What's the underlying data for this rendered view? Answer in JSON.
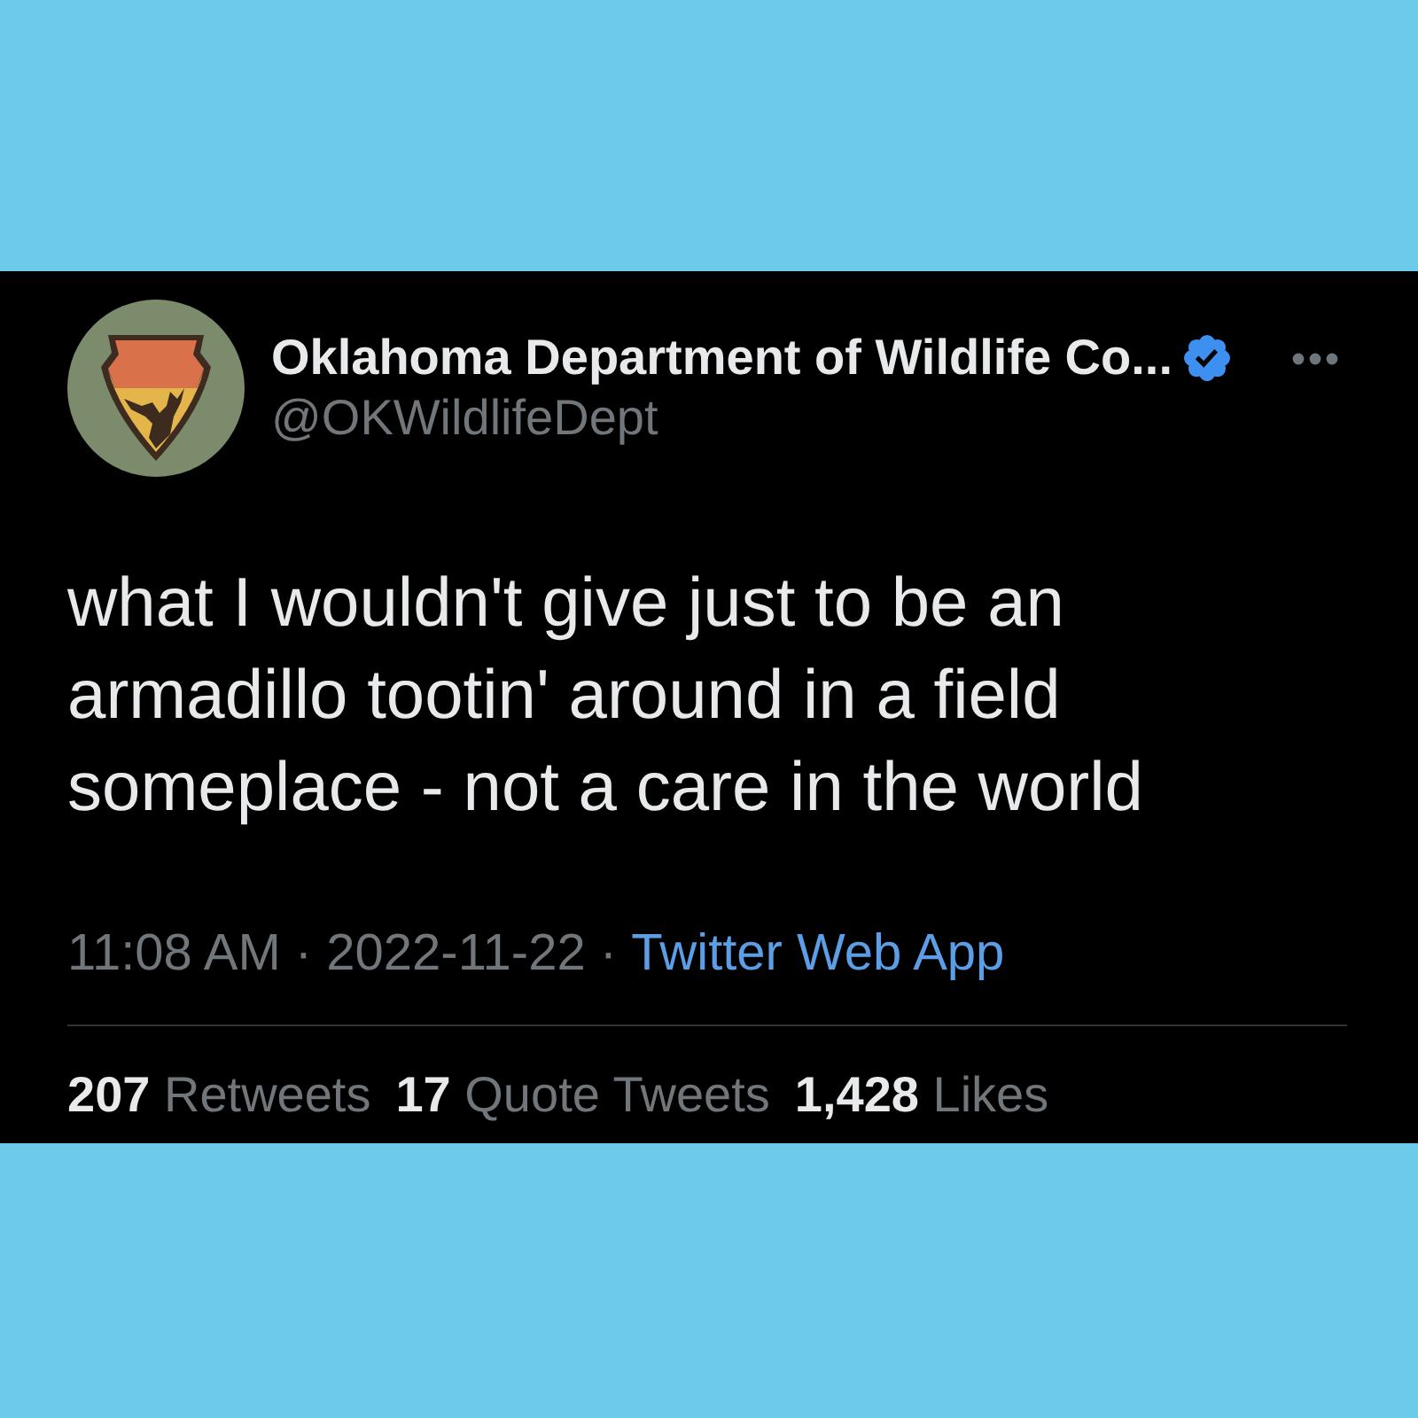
{
  "tweet": {
    "author": {
      "name": "Oklahoma Department of Wildlife Co...",
      "verified": true,
      "handle": "@OKWildlifeDept"
    },
    "text": "what I wouldn't give just to be an armadillo tootin' around in a field someplace - not a care in the world",
    "timestamp": "11:08 AM · 2022-11-22 ·",
    "source": "Twitter Web App",
    "stats": [
      {
        "text": "**207** Retweets"
      },
      {
        "text": "**17** Quote Tweets"
      },
      {
        "text": "**1,428** Likes"
      }
    ]
  }
}
